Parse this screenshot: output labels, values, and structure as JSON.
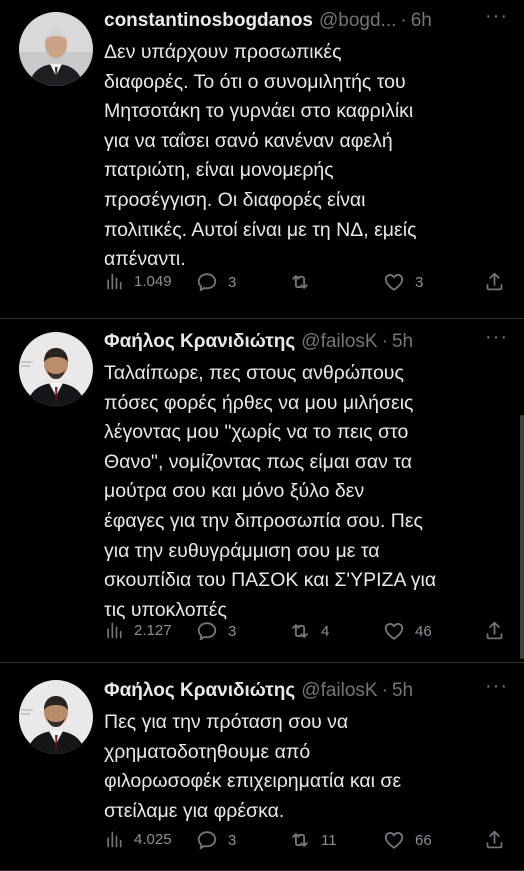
{
  "tweets": [
    {
      "name": "constantinosbogdanos",
      "handle": "@bogd...",
      "time": "6h",
      "text": "Δεν υπάρχουν προσωπικές\nδιαφορές. Το ότι ο συνομιλητής του\nΜητσοτάκη το γυρνάει στο καφριλίκι\nγια να ταΐσει σανό κανέναν αφελή\nπατριώτη, είναι μονομερής\nπροσέγγιση. Οι διαφορές είναι\nπολιτικές. Αυτοί είναι με τη ΝΔ, εμείς\nαπέναντι.",
      "views": "1.049",
      "replies": "3",
      "retweets": "",
      "likes": "3"
    },
    {
      "name": "Φαήλος Κρανιδιώτης",
      "handle": "@failosK",
      "time": "5h",
      "text": "Ταλαίπωρε, πες στους ανθρώπους\nπόσες φορές ήρθες να μου μιλήσεις\nλέγοντας μου \"χωρίς να το πεις στο\nΘανο\", νομίζοντας πως είμαι σαν τα\nμούτρα σου και μόνο ξύλο δεν\nέφαγες για την διπροσωπία σου. Πες\nγια την ευθυγράμμιση σου με τα\nσκουπίδια του ΠΑΣΟΚ και Σ'ΥΡΙΖΑ για\nτις υποκλοπές",
      "views": "2.127",
      "replies": "3",
      "retweets": "4",
      "likes": "46"
    },
    {
      "name": "Φαήλος Κρανιδιώτης",
      "handle": "@failosK",
      "time": "5h",
      "text": "Πες για την πρόταση σου να\nχρηματοδοτηθουμε από\nφιλορωσοφέκ επιχειρηματία και σε\nστείλαμε για φρέσκα.",
      "views": "4.025",
      "replies": "3",
      "retweets": "11",
      "likes": "66"
    }
  ],
  "ui": {
    "dot": "·",
    "more": "···"
  },
  "colors": {
    "background": "#000000",
    "text": "#e7e9ea",
    "muted": "#71767b",
    "divider": "#2f3336"
  },
  "icons": [
    "views-icon",
    "reply-icon",
    "retweet-icon",
    "like-icon",
    "share-icon",
    "more-icon"
  ]
}
